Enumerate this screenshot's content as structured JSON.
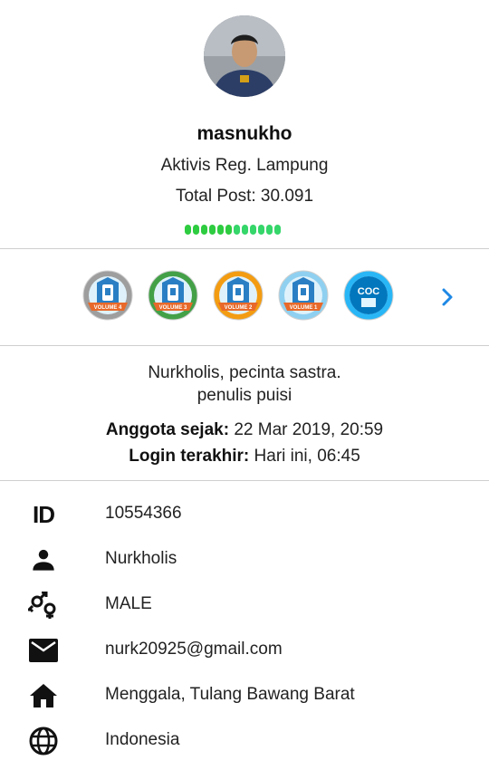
{
  "profile": {
    "username": "masnukho",
    "rank": "Aktivis Reg. Lampung",
    "total_post": "Total Post: 30.091",
    "reputation_colors": [
      "#2ecc40",
      "#2ecc40",
      "#2ecc40",
      "#2ecc40",
      "#2ecc40",
      "#2ecc40",
      "#35d66a",
      "#35d66a",
      "#35d66a",
      "#35d66a",
      "#35d66a",
      "#35d66a"
    ]
  },
  "badges": [
    {
      "name": "volume-4-badge",
      "color": "#9e9e9e",
      "label": "VOLUME 4"
    },
    {
      "name": "volume-3-badge",
      "color": "#43a047",
      "label": "VOLUME 3"
    },
    {
      "name": "volume-2-badge",
      "color": "#f39c12",
      "label": "VOLUME 2"
    },
    {
      "name": "volume-1-badge",
      "color": "#8fd0f0",
      "label": "VOLUME 1"
    },
    {
      "name": "coc-badge",
      "color": "#29b6f6",
      "label": "COC"
    }
  ],
  "bio": {
    "line1": "Nurkholis, pecinta sastra.",
    "line2": "penulis puisi"
  },
  "meta": {
    "joined_label": "Anggota sejak:",
    "joined_value": " 22 Mar 2019, 20:59",
    "last_login_label": "Login terakhir:",
    "last_login_value": " Hari ini, 06:45"
  },
  "info": {
    "id_icon": "ID",
    "id": "10554366",
    "name": "Nurkholis",
    "gender": "MALE",
    "email": "nurk20925@gmail.com",
    "location": "Menggala, Tulang Bawang Barat",
    "country": "Indonesia"
  },
  "colors": {
    "accent": "#1e88e5",
    "divider": "#cfcfcf"
  }
}
